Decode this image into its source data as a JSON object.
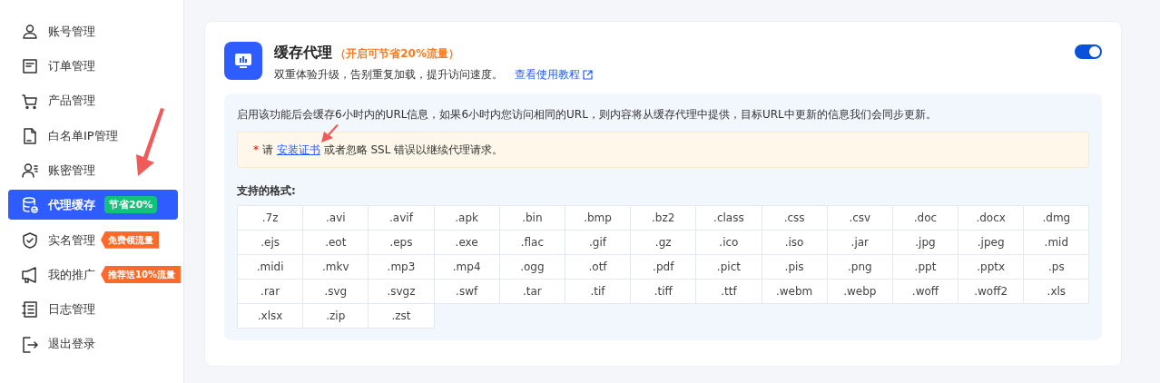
{
  "sidebar": {
    "items": [
      {
        "label": "账号管理",
        "selected": false
      },
      {
        "label": "订单管理",
        "selected": false
      },
      {
        "label": "产品管理",
        "selected": false
      },
      {
        "label": "白名单IP管理",
        "selected": false
      },
      {
        "label": "账密管理",
        "selected": false
      },
      {
        "label": "代理缓存",
        "selected": true,
        "badge": {
          "text": "节省20%",
          "kind": "pill",
          "color": "#12c27a"
        }
      },
      {
        "label": "实名管理",
        "selected": false,
        "badge": {
          "text": "免费领流量",
          "kind": "tag",
          "color": "#ff6a2b"
        }
      },
      {
        "label": "我的推广",
        "selected": false,
        "badge": {
          "text": "推荐送10%流量",
          "kind": "tag",
          "color": "#ff6a2b"
        }
      },
      {
        "label": "日志管理",
        "selected": false
      },
      {
        "label": "退出登录",
        "selected": false
      }
    ]
  },
  "panel": {
    "title": "缓存代理",
    "highlight": "（开启可节省20%流量）",
    "subtitle": "双重体验升级，告别重复加载，提升访问速度。",
    "tutorial_link": "查看使用教程",
    "enabled": true,
    "description": "启用该功能后会缓存6小时内的URL信息，如果6小时内您访问相同的URL，则内容将从缓存代理中提供，目标URL中更新的信息我们会同步更新。",
    "notice": {
      "mark": "*",
      "before": "请",
      "link": "安装证书",
      "after": "或者忽略 SSL 错误以继续代理请求。"
    },
    "formats_label": "支持的格式:",
    "formats": [
      ".7z",
      ".avi",
      ".avif",
      ".apk",
      ".bin",
      ".bmp",
      ".bz2",
      ".class",
      ".css",
      ".csv",
      ".doc",
      ".docx",
      ".dmg",
      ".ejs",
      ".eot",
      ".eps",
      ".exe",
      ".flac",
      ".gif",
      ".gz",
      ".ico",
      ".iso",
      ".jar",
      ".jpg",
      ".jpeg",
      ".mid",
      ".midi",
      ".mkv",
      ".mp3",
      ".mp4",
      ".ogg",
      ".otf",
      ".pdf",
      ".pict",
      ".pis",
      ".png",
      ".ppt",
      ".pptx",
      ".ps",
      ".rar",
      ".svg",
      ".svgz",
      ".swf",
      ".tar",
      ".tif",
      ".tiff",
      ".ttf",
      ".webm",
      ".webp",
      ".woff",
      ".woff2",
      ".xls",
      ".xlsx",
      ".zip",
      ".zst"
    ]
  }
}
